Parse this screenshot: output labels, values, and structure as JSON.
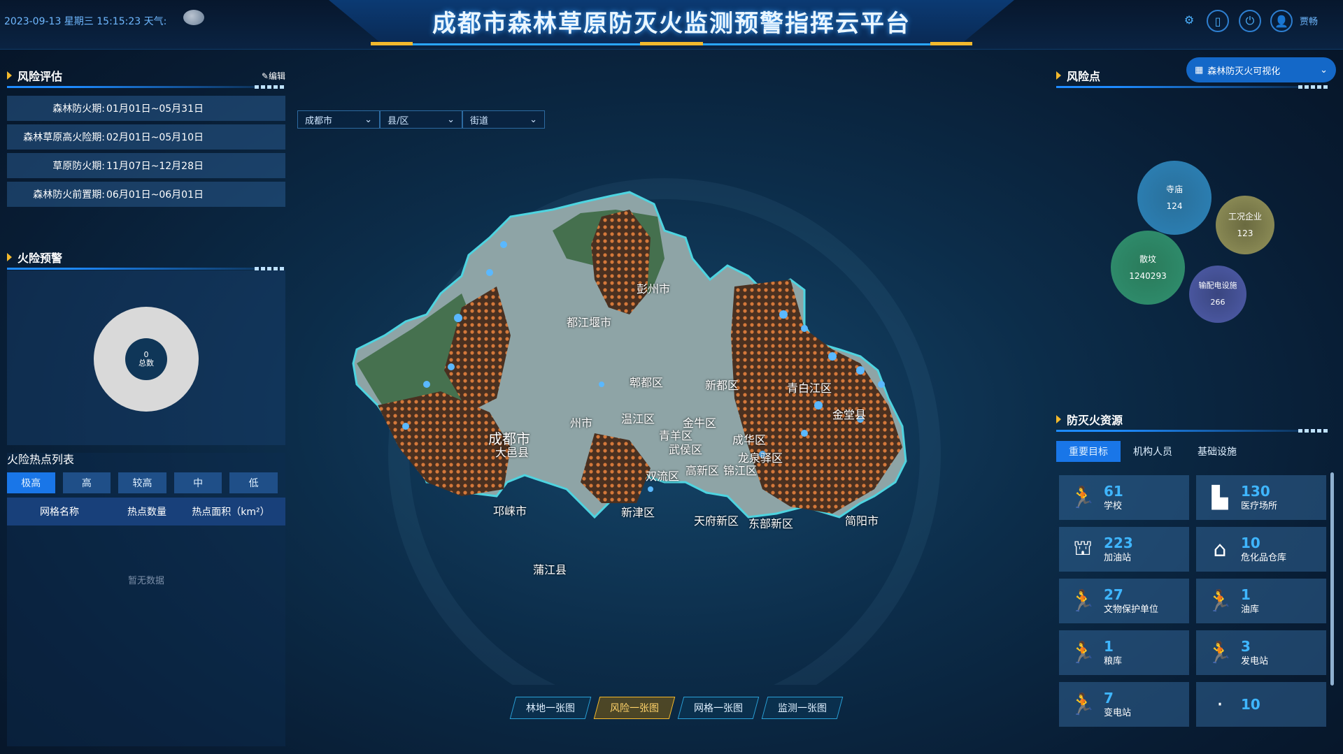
{
  "header": {
    "title": "成都市森林草原防灭火监测预警指挥云平台",
    "datetime": "2023-09-13 星期三 15:15:23 天气:",
    "username": "贾畅"
  },
  "risk_assessment": {
    "title": "风险评估",
    "edit_label": "编辑",
    "periods": [
      {
        "label": "森林防火期:",
        "value": "01月01日~05月31日"
      },
      {
        "label": "森林草原高火险期:",
        "value": "02月01日~05月10日"
      },
      {
        "label": "草原防火期:",
        "value": "11月07日~12月28日"
      },
      {
        "label": "森林防火前置期:",
        "value": "06月01日~06月01日"
      }
    ]
  },
  "fire_warning": {
    "title": "火险预警",
    "total_value": "0",
    "total_label": "总数"
  },
  "hotspot_list": {
    "title": "火险热点列表",
    "tabs": [
      "极高",
      "高",
      "较高",
      "中",
      "低"
    ],
    "columns": [
      "网格名称",
      "热点数量",
      "热点面积（km²）"
    ],
    "empty_text": "暂无数据"
  },
  "filters": {
    "city": "成都市",
    "district": "县/区",
    "street": "街道"
  },
  "map": {
    "labels": [
      "彭州市",
      "都江堰市",
      "郫都区",
      "新都区",
      "青白江区",
      "金堂县",
      "成都市",
      "大邑县",
      "州市",
      "温江区",
      "金牛区",
      "青羊区",
      "武侯区",
      "成华区",
      "龙泉驿区",
      "高新区",
      "锦江区",
      "双流区",
      "新津区",
      "邛崃市",
      "天府新区",
      "东部新区",
      "简阳市",
      "蒲江县"
    ],
    "tabs": [
      "林地一张图",
      "风险一张图",
      "网格一张图",
      "监测一张图"
    ],
    "active_tab": "风险一张图"
  },
  "risk_points": {
    "title": "风险点",
    "dropdown_label": "森林防灭火可视化",
    "bubbles": [
      {
        "name": "寺庙",
        "value": "124",
        "color": "#2b7db0"
      },
      {
        "name": "工况企业",
        "value": "123",
        "color": "#8a8a55"
      },
      {
        "name": "散坟",
        "value": "1240293",
        "color": "#2e8a6a"
      },
      {
        "name": "输配电设施",
        "value": "266",
        "color": "#4a57a0"
      }
    ]
  },
  "fire_resources": {
    "title": "防灭火资源",
    "tabs": [
      "重要目标",
      "机构人员",
      "基础设施"
    ],
    "cards": [
      {
        "value": "61",
        "name": "学校",
        "icon": "running-person-icon",
        "glyph": "🏃"
      },
      {
        "value": "130",
        "name": "医疗场所",
        "icon": "building-icon",
        "glyph": "▙"
      },
      {
        "value": "223",
        "name": "加油站",
        "icon": "gas-station-icon",
        "glyph": "⛫"
      },
      {
        "value": "10",
        "name": "危化品仓库",
        "icon": "warehouse-icon",
        "glyph": "⌂"
      },
      {
        "value": "27",
        "name": "文物保护单位",
        "icon": "running-person-icon",
        "glyph": "🏃"
      },
      {
        "value": "1",
        "name": "油库",
        "icon": "running-person-icon",
        "glyph": "🏃"
      },
      {
        "value": "1",
        "name": "粮库",
        "icon": "running-person-icon",
        "glyph": "🏃"
      },
      {
        "value": "3",
        "name": "发电站",
        "icon": "running-person-icon",
        "glyph": "🏃"
      },
      {
        "value": "7",
        "name": "变电站",
        "icon": "running-person-icon",
        "glyph": "🏃"
      },
      {
        "value": "10",
        "name": "",
        "icon": "placeholder-icon",
        "glyph": "·"
      }
    ]
  }
}
